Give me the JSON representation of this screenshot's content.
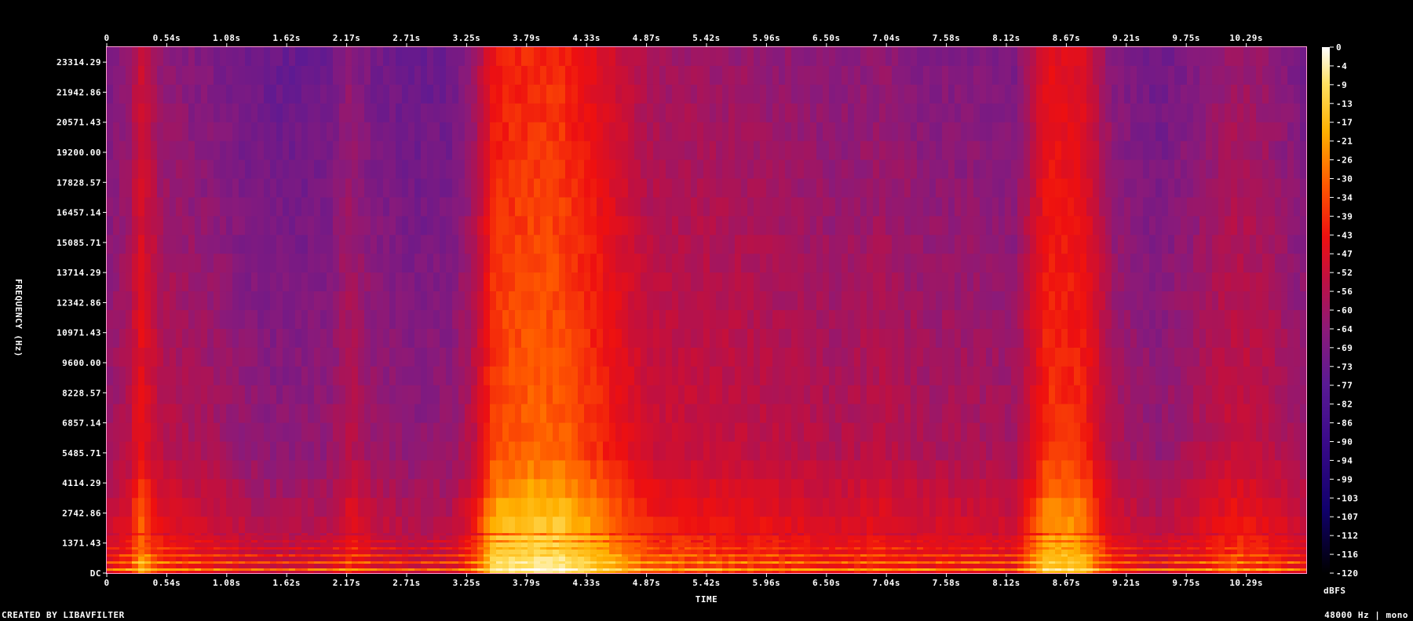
{
  "chart_data": {
    "type": "heatmap",
    "title": "",
    "xlabel": "TIME",
    "ylabel": "FREQUENCY (Hz)",
    "x_ticks": [
      "0",
      "0.54s",
      "1.08s",
      "1.62s",
      "2.17s",
      "2.71s",
      "3.25s",
      "3.79s",
      "4.33s",
      "4.87s",
      "5.42s",
      "5.96s",
      "6.50s",
      "7.04s",
      "7.58s",
      "8.12s",
      "8.67s",
      "9.21s",
      "9.75s",
      "10.29s"
    ],
    "y_ticks": [
      "DC",
      "1371.43",
      "2742.86",
      "4114.29",
      "5485.71",
      "6857.14",
      "8228.57",
      "9600.00",
      "10971.43",
      "12342.86",
      "13714.29",
      "15085.71",
      "16457.14",
      "17828.57",
      "19200.00",
      "20571.43",
      "21942.86",
      "23314.29"
    ],
    "xlim_s": [
      0,
      10.83
    ],
    "ylim_hz": [
      0,
      24000
    ],
    "colorbar_label": "dBFS",
    "colorbar_ticks": [
      "0",
      "-4",
      "-9",
      "-13",
      "-17",
      "-21",
      "-26",
      "-30",
      "-34",
      "-39",
      "-43",
      "-47",
      "-52",
      "-56",
      "-60",
      "-64",
      "-69",
      "-73",
      "-77",
      "-82",
      "-86",
      "-90",
      "-94",
      "-99",
      "-103",
      "-107",
      "-112",
      "-116",
      "-120"
    ],
    "colormap_stops": [
      "#000000",
      "#10006b",
      "#3a0a8a",
      "#5a1a94",
      "#8a1a7a",
      "#c01040",
      "#ee1010",
      "#ff5a00",
      "#ffb000",
      "#ffe060",
      "#ffffff"
    ],
    "energy_profile": {
      "time_s": [
        0,
        0.2,
        0.3,
        0.5,
        0.8,
        1.0,
        1.3,
        1.6,
        2.0,
        2.2,
        2.4,
        2.8,
        3.1,
        3.3,
        3.5,
        3.8,
        4.1,
        4.5,
        4.9,
        5.3,
        5.7,
        6.2,
        6.6,
        7.0,
        7.4,
        7.8,
        8.2,
        8.5,
        8.8,
        9.1,
        9.5,
        9.8,
        10.2,
        10.5,
        10.83
      ],
      "relative_level": [
        0.45,
        0.55,
        0.75,
        0.55,
        0.5,
        0.48,
        0.42,
        0.4,
        0.42,
        0.55,
        0.45,
        0.4,
        0.42,
        0.55,
        0.9,
        0.95,
        0.95,
        0.8,
        0.62,
        0.6,
        0.58,
        0.55,
        0.52,
        0.55,
        0.5,
        0.5,
        0.48,
        0.85,
        0.82,
        0.5,
        0.42,
        0.5,
        0.6,
        0.55,
        0.45
      ]
    }
  },
  "footer": {
    "left": "CREATED BY LIBAVFILTER",
    "right": "48000 Hz | mono"
  }
}
